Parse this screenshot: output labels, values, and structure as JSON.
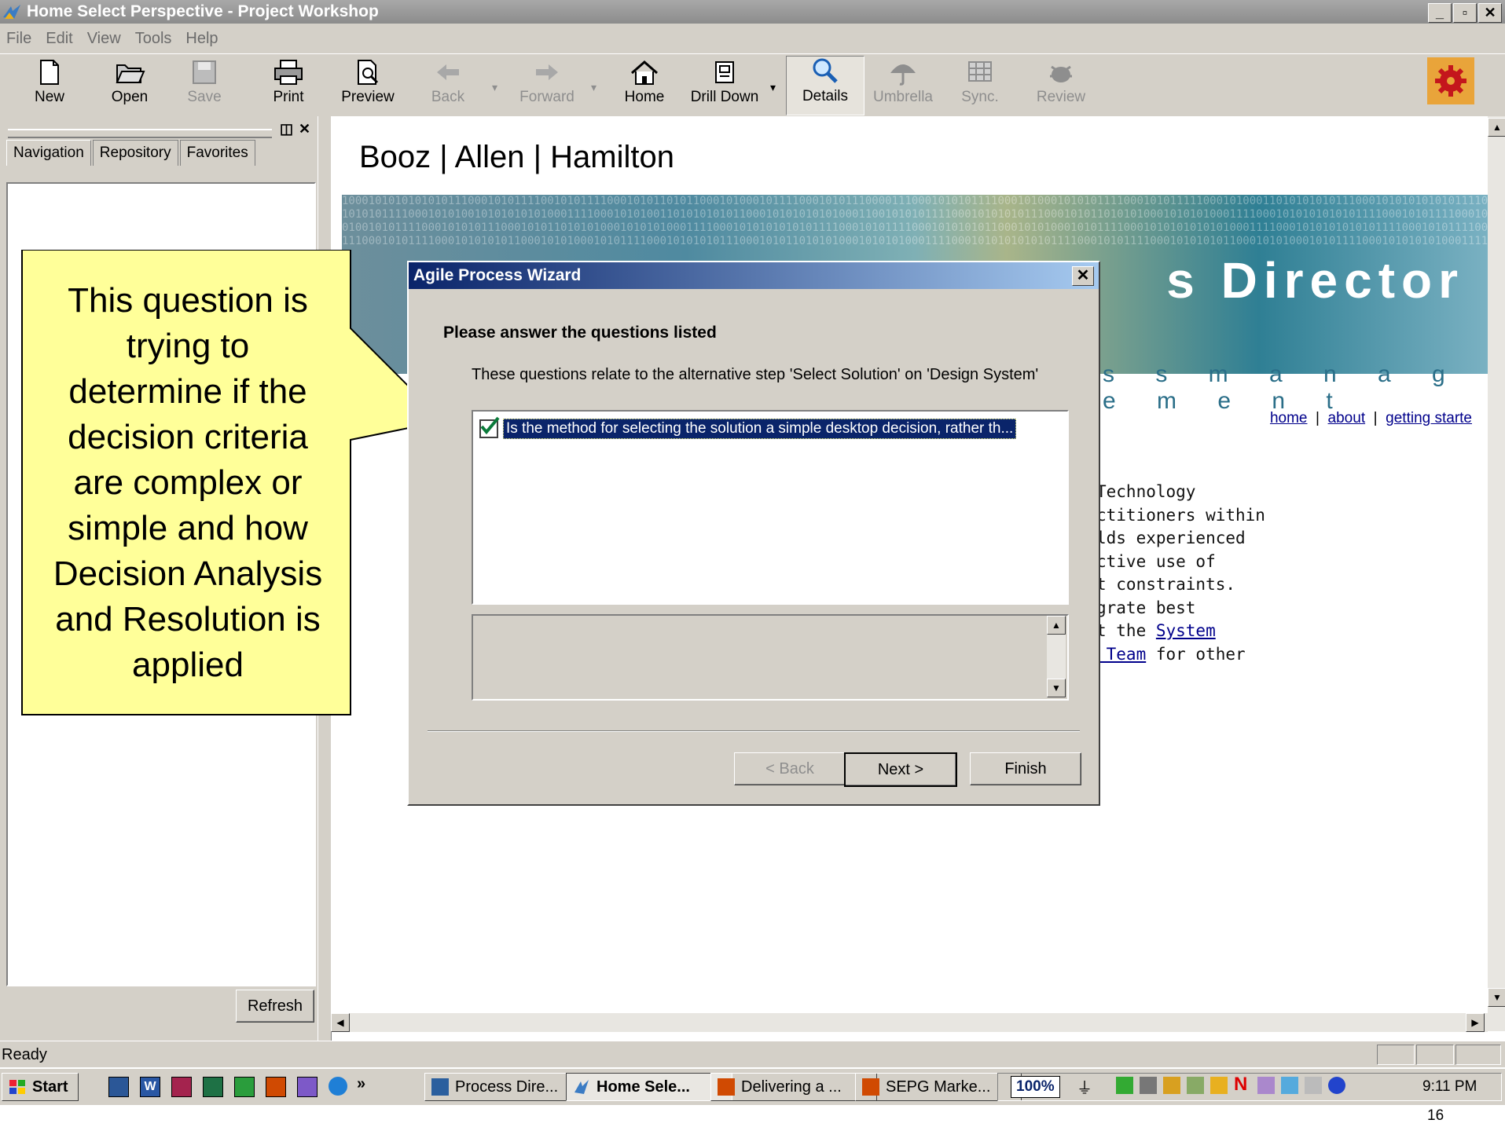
{
  "window": {
    "title": "Home Select Perspective - Project Workshop"
  },
  "menu": [
    "File",
    "Edit",
    "View",
    "Tools",
    "Help"
  ],
  "toolbar": {
    "new": "New",
    "open": "Open",
    "save": "Save",
    "print": "Print",
    "preview": "Preview",
    "back": "Back",
    "forward": "Forward",
    "home": "Home",
    "drilldown": "Drill Down",
    "details": "Details",
    "umbrella": "Umbrella",
    "sync": "Sync.",
    "review": "Review"
  },
  "leftpane": {
    "tabs": [
      "Navigation",
      "Repository",
      "Favorites"
    ],
    "refresh": "Refresh"
  },
  "content": {
    "logo": "Booz | Allen | Hamilton",
    "banner_word": "s Director",
    "tagline": "s s m a n a g e m e n t",
    "links": {
      "home": "home",
      "about": "about",
      "getting_started": "getting starte"
    },
    "para": [
      "Technology",
      "ctitioners within",
      "lds experienced",
      "ctive use of",
      "t constraints.",
      "grate best",
      "t the ",
      " Team",
      " for other"
    ],
    "para_links": {
      "system": "System"
    }
  },
  "dialog": {
    "title": "Agile Process Wizard",
    "heading": "Please answer the questions listed",
    "subtitle": "These questions relate to the alternative step 'Select Solution' on 'Design System'",
    "question": "Is the method for selecting the solution a simple desktop decision, rather th...",
    "question_checked": true,
    "back": "< Back",
    "next": "Next >",
    "finish": "Finish"
  },
  "callout": {
    "lines": [
      "This question is",
      "trying to",
      "determine if the",
      "decision criteria",
      "are complex or",
      "simple and how",
      "Decision Analysis",
      "and Resolution is",
      "applied"
    ]
  },
  "status": {
    "text": "Ready"
  },
  "taskbar": {
    "start": "Start",
    "chevron": "»",
    "tasks": [
      "Process Dire...",
      "Home Sele...",
      "Delivering a ...",
      "SEPG Marke..."
    ],
    "zoom": "100%",
    "clock": "9:11 PM"
  },
  "page_number": "16"
}
